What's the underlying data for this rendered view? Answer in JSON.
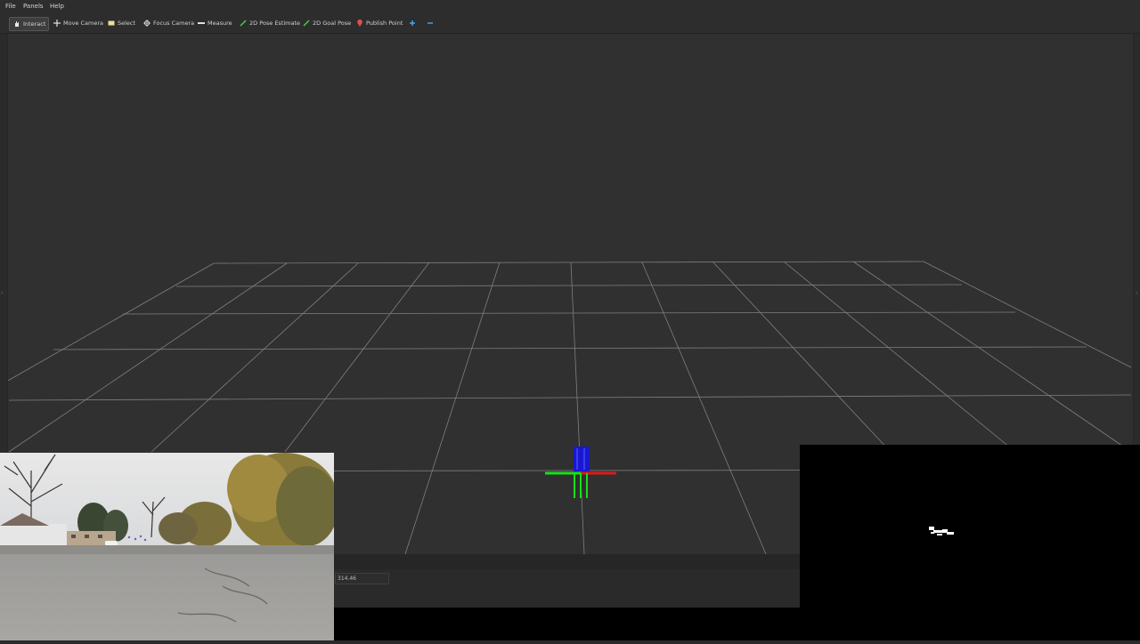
{
  "menubar": {
    "items": [
      {
        "label": "File"
      },
      {
        "label": "Panels"
      },
      {
        "label": "Help"
      }
    ]
  },
  "toolbar": {
    "tools": [
      {
        "label": "Interact",
        "icon": "hand-icon",
        "active": true
      },
      {
        "label": "Move Camera",
        "icon": "move-icon",
        "active": false
      },
      {
        "label": "Select",
        "icon": "select-icon",
        "active": false
      },
      {
        "label": "Focus Camera",
        "icon": "focus-icon",
        "active": false
      },
      {
        "label": "Measure",
        "icon": "ruler-icon",
        "active": false
      },
      {
        "label": "2D Pose Estimate",
        "icon": "pose-estimate-icon",
        "active": false
      },
      {
        "label": "2D Goal Pose",
        "icon": "goal-pose-icon",
        "active": false
      },
      {
        "label": "Publish Point",
        "icon": "publish-point-icon",
        "active": false
      }
    ],
    "add_tool_icon": "plus-icon",
    "remove_tool_icon": "minus-icon"
  },
  "time_panel": {
    "value": "314.46"
  },
  "colors": {
    "background": "#303030",
    "grid": "#a0a0a0",
    "axis_x": "#ff2020",
    "axis_y": "#20e020",
    "axis_z": "#2020ff",
    "accent": "#3fa9f5"
  }
}
